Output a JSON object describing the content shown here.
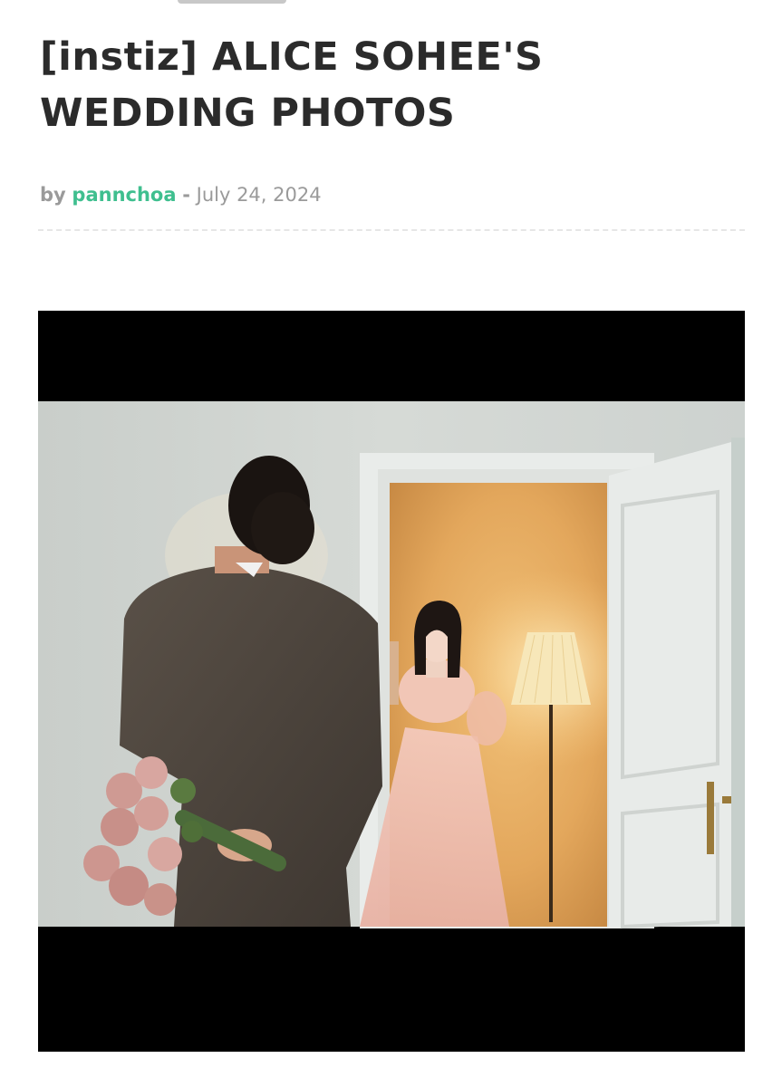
{
  "article": {
    "title": "[instiz] ALICE SOHEE'S WEDDING PHOTOS",
    "byline": {
      "by_label": "by",
      "author": "pannchoa",
      "separator": "-",
      "date": "July 24, 2024"
    }
  },
  "colors": {
    "author_link": "#3fbf8f",
    "title_text": "#2b2b2b",
    "meta_text": "#9a9a9a"
  }
}
